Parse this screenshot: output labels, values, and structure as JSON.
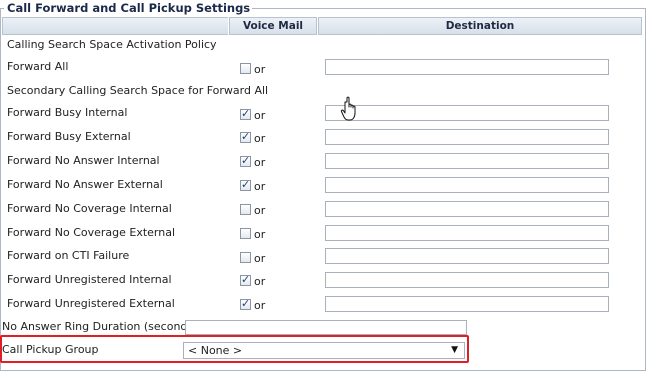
{
  "section": {
    "title": "Call Forward and Call Pickup Settings",
    "columns": {
      "voice_mail": "Voice Mail",
      "destination": "Destination"
    }
  },
  "rows": [
    {
      "label": "Calling Search Space Activation Policy"
    },
    {
      "label": "Forward All",
      "voice_mail": false,
      "or": "or",
      "destination": ""
    },
    {
      "label": "Secondary Calling Search Space for Forward All"
    },
    {
      "label": "Forward Busy Internal",
      "voice_mail": true,
      "or": "or",
      "destination": ""
    },
    {
      "label": "Forward Busy External",
      "voice_mail": true,
      "or": "or",
      "destination": ""
    },
    {
      "label": "Forward No Answer Internal",
      "voice_mail": true,
      "or": "or",
      "destination": ""
    },
    {
      "label": "Forward No Answer External",
      "voice_mail": true,
      "or": "or",
      "destination": ""
    },
    {
      "label": "Forward No Coverage Internal",
      "voice_mail": false,
      "or": "or",
      "destination": ""
    },
    {
      "label": "Forward No Coverage External",
      "voice_mail": false,
      "or": "or",
      "destination": ""
    },
    {
      "label": "Forward on CTI Failure",
      "voice_mail": false,
      "or": "or",
      "destination": ""
    },
    {
      "label": "Forward Unregistered Internal",
      "voice_mail": true,
      "or": "or",
      "destination": ""
    },
    {
      "label": "Forward Unregistered External",
      "voice_mail": true,
      "or": "or",
      "destination": ""
    }
  ],
  "ring_duration": {
    "label": "No Answer Ring Duration (seconds)",
    "value": ""
  },
  "pickup_group": {
    "label": "Call Pickup Group",
    "selected": "< None >"
  },
  "colors": {
    "highlight": "#e01e24",
    "header_bg": "#d7dfe9"
  },
  "icons": {
    "cursor": "hand-pointer-icon",
    "dropdown": "chevron-down-icon"
  }
}
